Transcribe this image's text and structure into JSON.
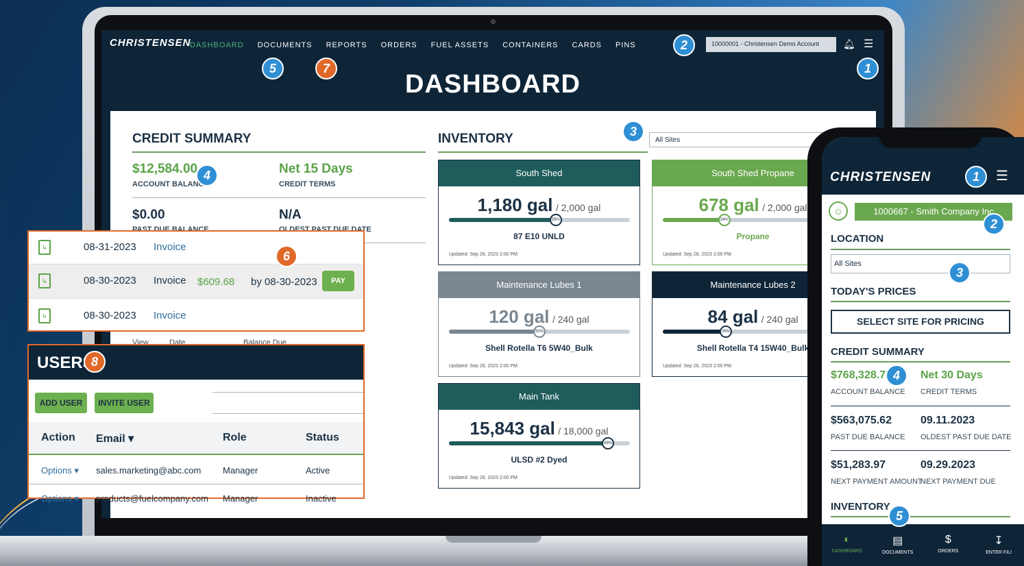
{
  "laptop": {
    "logo": "CHRISTENSEN",
    "nav": [
      "DASHBOARD",
      "DOCUMENTS",
      "REPORTS",
      "ORDERS",
      "FUEL ASSETS",
      "CONTAINERS",
      "CARDS",
      "PINS"
    ],
    "account_select": "10000001 - Christensen Demo Account",
    "title": "DASHBOARD",
    "credit": {
      "heading": "CREDIT SUMMARY",
      "balance": "$12,584.00",
      "balance_label": "ACCOUNT BALANCE",
      "terms": "Net 15 Days",
      "terms_label": "CREDIT TERMS",
      "past_due": "$0.00",
      "past_due_label": "PAST DUE BALANCE",
      "oldest": "N/A",
      "oldest_label": "OLDEST PAST DUE DATE"
    },
    "inventory": {
      "heading": "INVENTORY",
      "site_select": "All Sites",
      "cards": [
        {
          "name": "South Shed",
          "amount": "1,180 gal",
          "capacity": "/ 2,000 gal",
          "pct": "59%",
          "fill": 0.59,
          "product": "87 E10 UNLD",
          "updated": "Updated: Sep 28, 2023 2:00 PM",
          "color": "#1f5c5c"
        },
        {
          "name": "South Shed Propane",
          "amount": "678 gal",
          "capacity": "/ 2,000 gal",
          "pct": "34%",
          "fill": 0.34,
          "product": "Propane",
          "updated": "Updated: Sep 28, 2023 2:00 PM",
          "color": "#6aa84f"
        },
        {
          "name": "Maintenance Lubes 1",
          "amount": "120 gal",
          "capacity": "/ 240 gal",
          "pct": "50%",
          "fill": 0.5,
          "product": "Shell Rotella T6 5W40_Bulk",
          "updated": "Updated: Sep 28, 2023 2:00 PM",
          "color": "#7a8791"
        },
        {
          "name": "Maintenance Lubes 2",
          "amount": "84 gal",
          "capacity": "/ 240 gal",
          "pct": "35%",
          "fill": 0.35,
          "product": "Shell Rotella T4 15W40_Bulk",
          "updated": "Updated: Sep 28, 2023 2:00 PM",
          "color": "#0e2538"
        },
        {
          "name": "Main Tank",
          "amount": "15,843 gal",
          "capacity": "/ 18,000 gal",
          "pct": "88%",
          "fill": 0.88,
          "product": "ULSD #2 Dyed",
          "updated": "Updated: Sep 28, 2023 2:00 PM",
          "color": "#1f5c5c"
        }
      ]
    },
    "hidden_cols": {
      "view": "View",
      "date": "Date",
      "balance_due": "Balance Due"
    }
  },
  "invoices": [
    {
      "date": "08-31-2023",
      "type": "Invoice"
    },
    {
      "date": "08-30-2023",
      "type": "Invoice",
      "amount": "$609.68",
      "due": "by 08-30-2023",
      "action": "PAY"
    },
    {
      "date": "08-30-2023",
      "type": "Invoice"
    }
  ],
  "users": {
    "heading": "USERS",
    "add_user": "ADD USER",
    "invite_user": "INVITE USER",
    "columns": [
      "Action",
      "Email ▾",
      "Role",
      "Status"
    ],
    "rows": [
      {
        "action": "Options ▾",
        "email": "sales.marketing@abc.com",
        "role": "Manager",
        "status": "Active"
      },
      {
        "action": "Options ▾",
        "email": "products@fuelcompany.com",
        "role": "Manager",
        "status": "Inactive"
      }
    ]
  },
  "phone": {
    "logo": "CHRISTENSEN",
    "account": "1000667 - Smith Company Inc",
    "location_heading": "LOCATION",
    "site_select": "All Sites",
    "prices_heading": "TODAY'S PRICES",
    "pricing_button": "SELECT SITE FOR PRICING",
    "credit_heading": "CREDIT SUMMARY",
    "balance": "$768,328.71",
    "balance_label": "ACCOUNT BALANCE",
    "terms": "Net 30 Days",
    "terms_label": "CREDIT TERMS",
    "past_due": "$563,075.62",
    "past_due_label": "PAST DUE BALANCE",
    "oldest": "09.11.2023",
    "oldest_label": "OLDEST PAST DUE DATE",
    "next_amount": "$51,283.97",
    "next_amount_label": "NEXT PAYMENT AMOUNT",
    "next_due": "09.29.2023",
    "next_due_label": "NEXT PAYMENT DUE",
    "inventory_heading": "INVENTORY",
    "tabs": [
      "DASHBOARD",
      "DOCUMENTS",
      "ORDERS",
      "ENTER FILI"
    ]
  },
  "badges": {
    "one": "1",
    "two": "2",
    "three": "3",
    "four": "4",
    "five": "5",
    "six": "6",
    "seven": "7",
    "eight": "8"
  },
  "colors": {
    "navy": "#0e2538",
    "green": "#5aa348",
    "orange": "#e0692a",
    "blue": "#2f8fd4"
  }
}
